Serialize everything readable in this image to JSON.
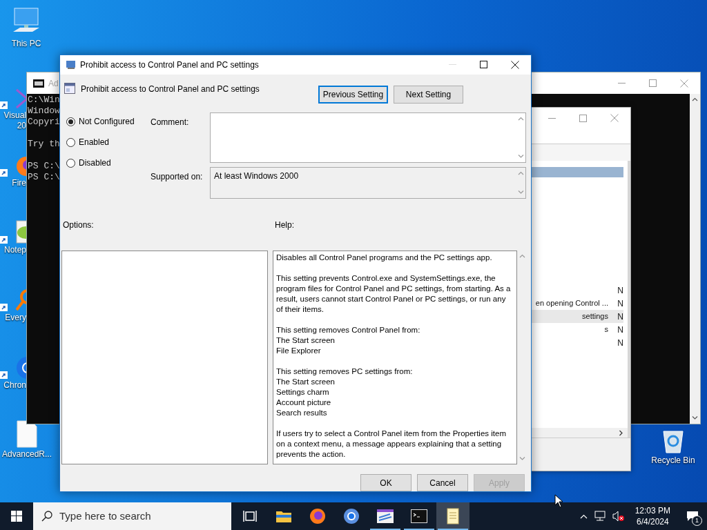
{
  "desktop": {
    "icons": [
      {
        "kind": "pc",
        "label": "This PC"
      },
      {
        "kind": "vs",
        "label": "Visual 20"
      },
      {
        "kind": "firefox",
        "label": "Fire"
      },
      {
        "kind": "notepadpp",
        "label": "Notep"
      },
      {
        "kind": "everything",
        "label": "Every"
      },
      {
        "kind": "chrome",
        "label": "Chron"
      },
      {
        "kind": "document",
        "label": "AdvancedR..."
      },
      {
        "kind": "recycle",
        "label": "Recycle Bin"
      }
    ]
  },
  "console_window": {
    "title": "Ad",
    "blocks": [
      [
        "C:\\Win",
        "Window",
        "Copyri"
      ],
      [
        "Try th"
      ],
      [
        "PS C:\\",
        "PS C:\\"
      ]
    ]
  },
  "editor_window": {
    "folder_row": {
      "selected": true
    },
    "rows": [
      {
        "state": "N",
        "selected": false
      },
      {
        "setting": "en opening Control ...",
        "state": "N",
        "selected": false
      },
      {
        "setting": "settings",
        "state": "N",
        "selected": true
      },
      {
        "setting": "s",
        "state": "N",
        "selected": false
      },
      {
        "state": "N",
        "selected": false
      }
    ]
  },
  "dialog": {
    "title": "Prohibit access to Control Panel and PC settings",
    "setting_name": "Prohibit access to Control Panel and PC settings",
    "nav_buttons": [
      {
        "label": "Previous Setting",
        "focused": true
      },
      {
        "label": "Next Setting",
        "focused": false
      }
    ],
    "states": [
      {
        "label": "Not Configured",
        "selected": true
      },
      {
        "label": "Enabled",
        "selected": false
      },
      {
        "label": "Disabled",
        "selected": false
      }
    ],
    "comment_label": "Comment:",
    "supported_label": "Supported on:",
    "supported_value": "At least Windows 2000",
    "options_label": "Options:",
    "help_label": "Help:",
    "help": [
      [
        "Disables all Control Panel programs and the PC settings app."
      ],
      [
        "This setting prevents Control.exe and SystemSettings.exe, the program files for Control Panel and PC settings, from starting. As a result, users cannot start Control Panel or PC settings, or run any of their items."
      ],
      [
        "This setting removes Control Panel from:",
        "The Start screen",
        "File Explorer"
      ],
      [
        "This setting removes PC settings from:",
        "The Start screen",
        "Settings charm",
        "Account picture",
        "Search results"
      ],
      [
        "If users try to select a Control Panel item from the Properties item on a context menu, a message appears explaining that a setting prevents the action."
      ]
    ],
    "buttons": [
      {
        "label": "OK",
        "disabled": false
      },
      {
        "label": "Cancel",
        "disabled": false
      },
      {
        "label": "Apply",
        "disabled": true
      }
    ]
  },
  "taskbar": {
    "search_placeholder": "Type here to search",
    "apps": [
      {
        "kind": "taskview",
        "running": false,
        "active": false
      },
      {
        "kind": "explorer",
        "running": false,
        "active": false
      },
      {
        "kind": "firefox",
        "running": false,
        "active": false
      },
      {
        "kind": "chrome",
        "running": false,
        "active": false
      },
      {
        "kind": "gpedit",
        "running": true,
        "active": false
      },
      {
        "kind": "terminal",
        "running": true,
        "active": false
      },
      {
        "kind": "notepad",
        "running": true,
        "active": true
      }
    ],
    "time": "12:03 PM",
    "date": "6/4/2024",
    "notification_count": "1"
  }
}
